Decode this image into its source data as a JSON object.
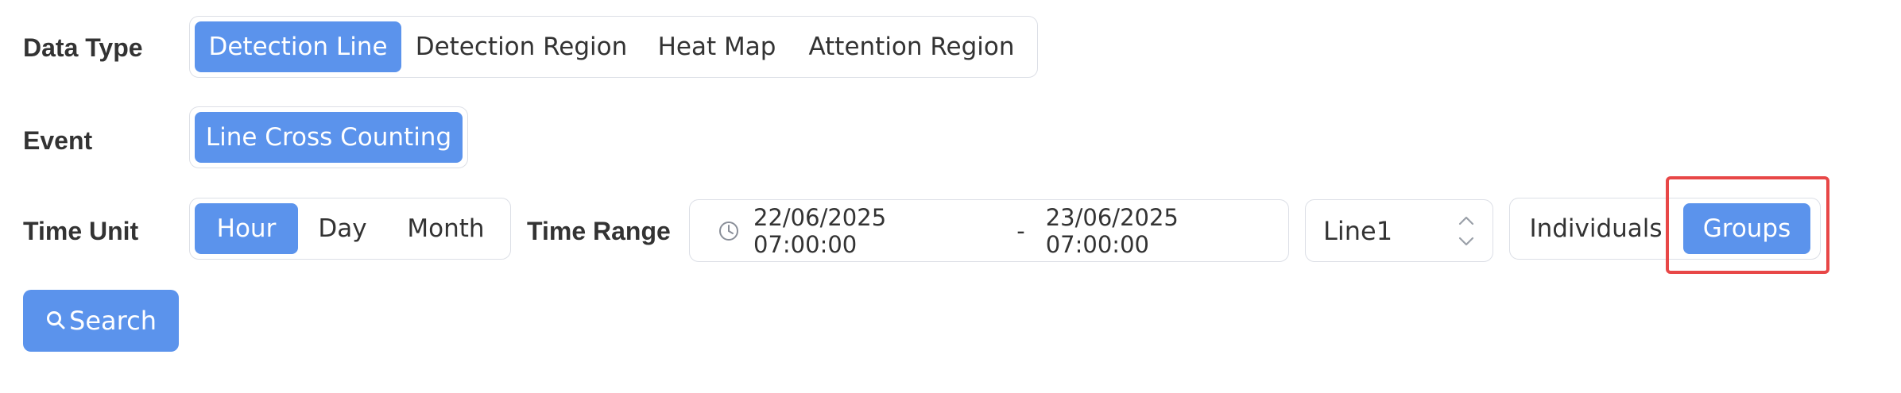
{
  "data_type": {
    "label": "Data Type",
    "options": [
      "Detection Line",
      "Detection Region",
      "Heat Map",
      "Attention Region"
    ],
    "selected": "Detection Line"
  },
  "event": {
    "label": "Event",
    "options": [
      "Line Cross Counting"
    ],
    "selected": "Line Cross Counting"
  },
  "time_unit": {
    "label": "Time Unit",
    "options": [
      "Hour",
      "Day",
      "Month"
    ],
    "selected": "Hour"
  },
  "time_range": {
    "label": "Time Range",
    "start": "22/06/2025 07:00:00",
    "separator": "-",
    "end": "23/06/2025 07:00:00"
  },
  "line_select": {
    "value": "Line1"
  },
  "view_mode": {
    "options": [
      "Individuals",
      "Groups"
    ],
    "selected": "Groups"
  },
  "search_button": {
    "label": "Search"
  },
  "colors": {
    "accent": "#5b93ec",
    "highlight": "#e84747",
    "border": "#dcdfe6"
  }
}
